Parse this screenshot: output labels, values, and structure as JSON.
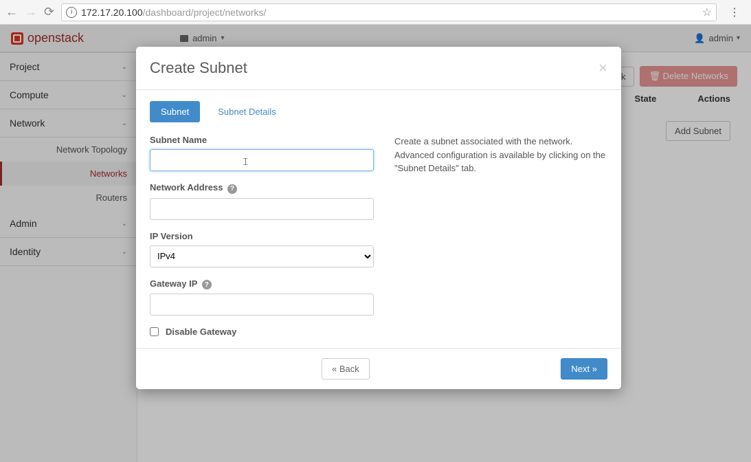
{
  "browser": {
    "url_host": "172.17.20.100",
    "url_path": "/dashboard/project/networks/"
  },
  "topbar": {
    "brand": "openstack",
    "project": "admin",
    "user": "admin"
  },
  "sidebar": {
    "project": "Project",
    "compute": "Compute",
    "network": "Network",
    "subs": {
      "topology": "Network Topology",
      "networks": "Networks",
      "routers": "Routers"
    },
    "admin": "Admin",
    "identity": "Identity"
  },
  "main": {
    "create_network": "Network",
    "delete_networks": "Delete Networks",
    "col_state": "State",
    "col_actions": "Actions",
    "add_subnet": "Add Subnet"
  },
  "modal": {
    "title": "Create Subnet",
    "tabs": {
      "subnet": "Subnet",
      "details": "Subnet Details"
    },
    "labels": {
      "subnet_name": "Subnet Name",
      "network_address": "Network Address",
      "ip_version": "IP Version",
      "gateway_ip": "Gateway IP",
      "disable_gateway": "Disable Gateway"
    },
    "values": {
      "subnet_name": "",
      "network_address": "",
      "ip_version": "IPv4",
      "gateway_ip": "",
      "disable_gateway_checked": false
    },
    "help_text": "Create a subnet associated with the network. Advanced configuration is available by clicking on the \"Subnet Details\" tab.",
    "footer": {
      "back": "« Back",
      "next": "Next »"
    }
  },
  "icons": {
    "trash": "🗑"
  }
}
